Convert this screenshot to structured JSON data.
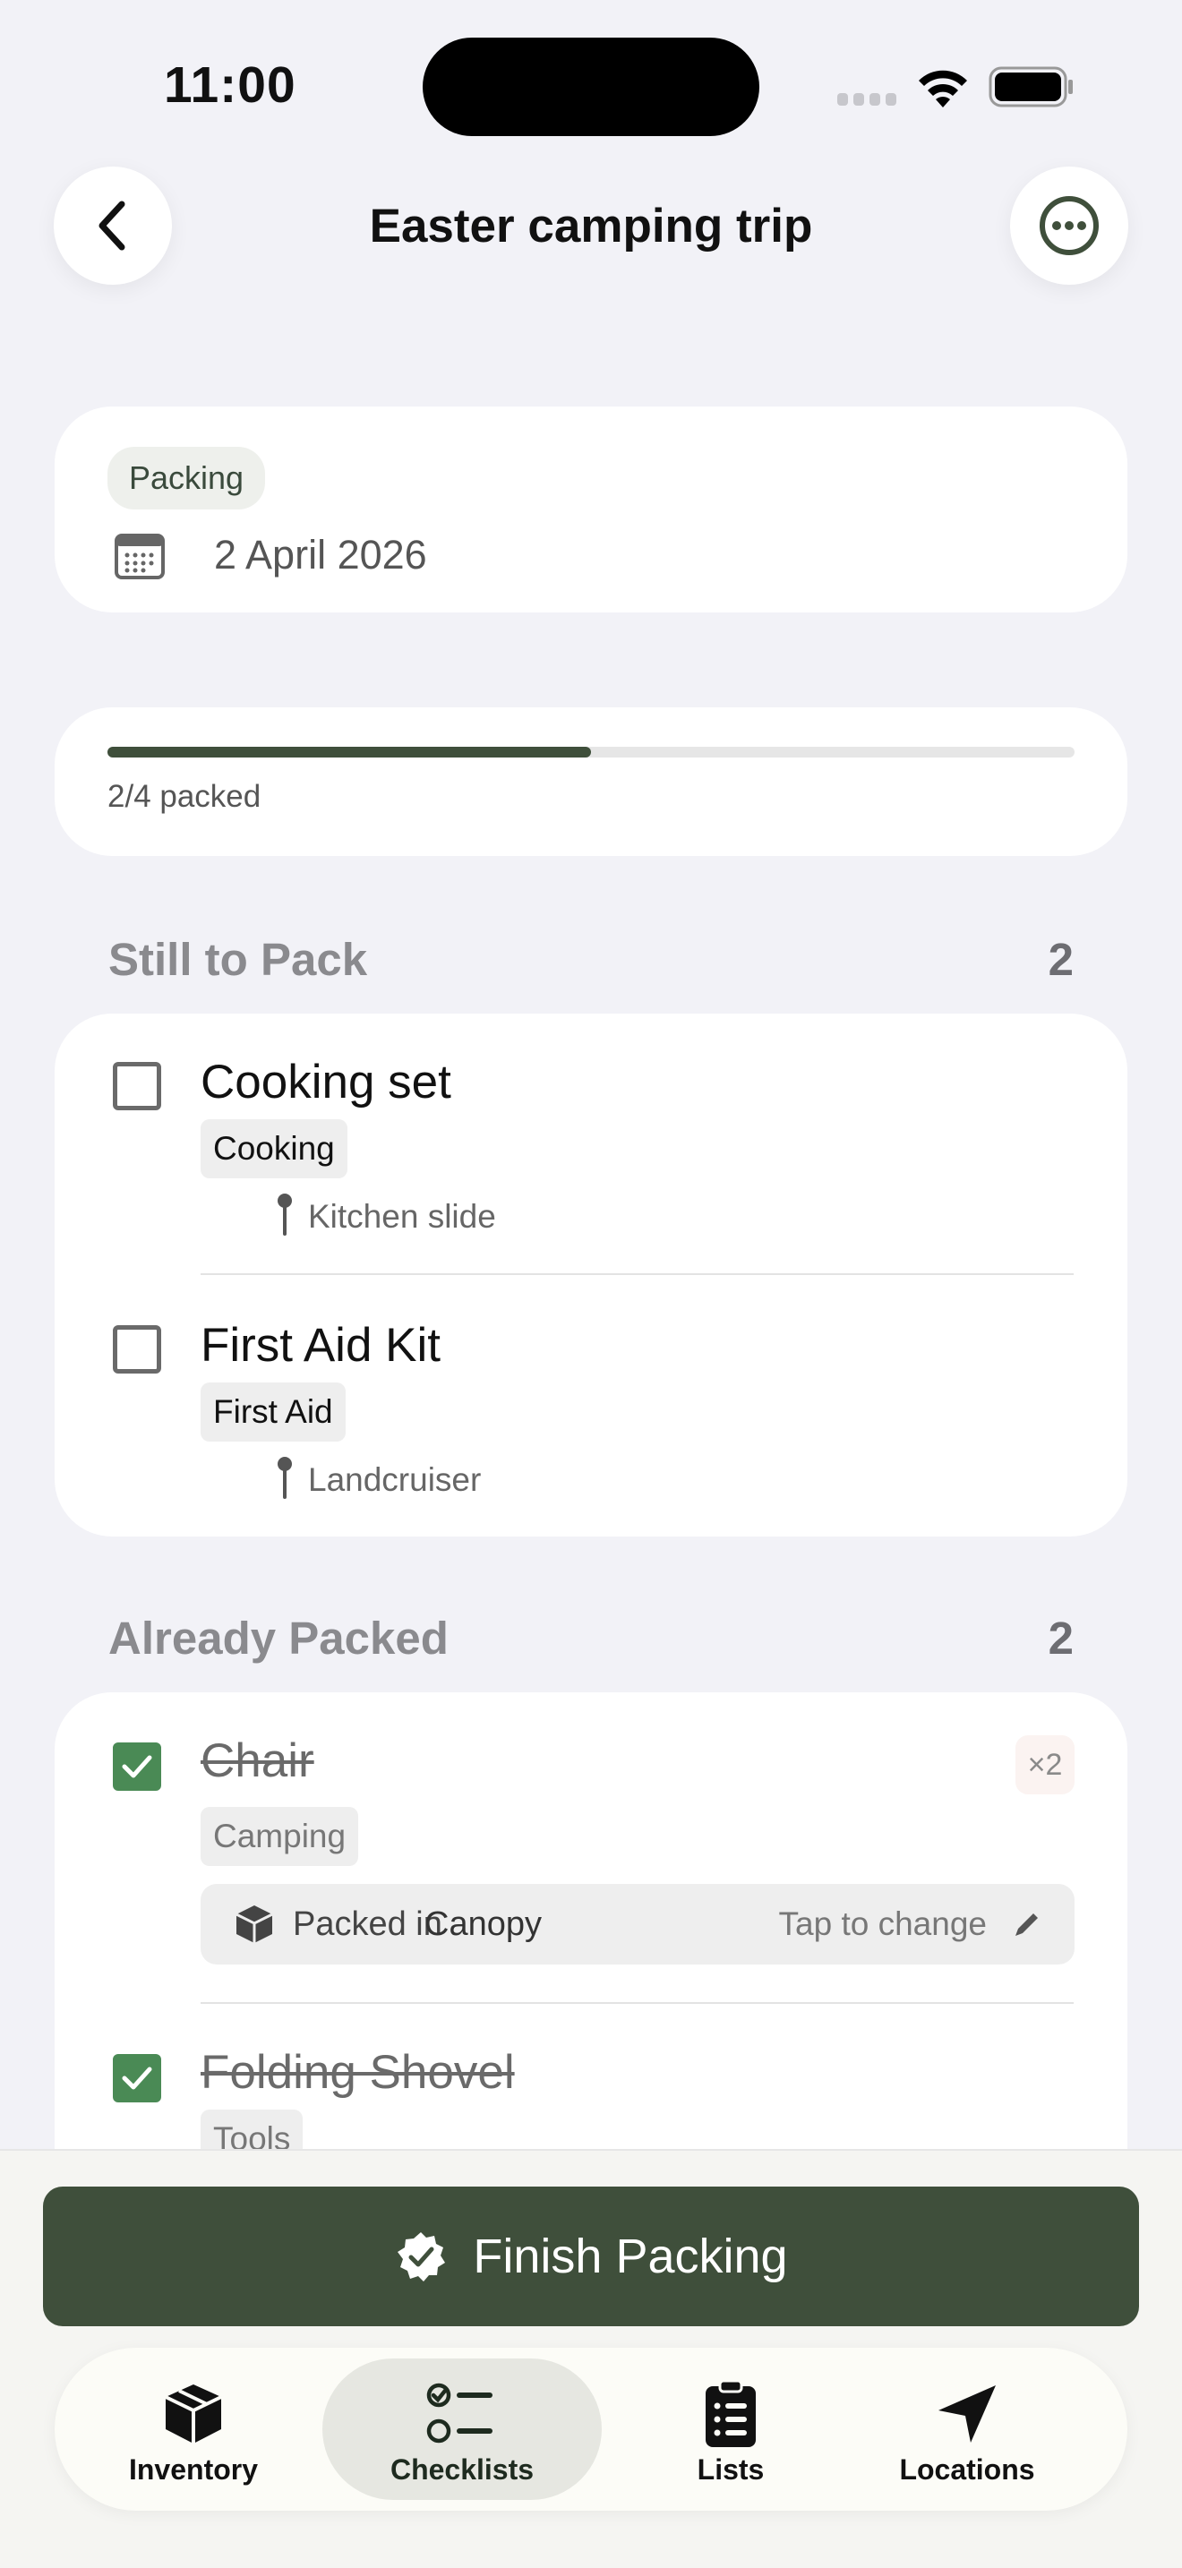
{
  "status_bar": {
    "time": "11:00"
  },
  "nav": {
    "title": "Easter camping trip"
  },
  "summary": {
    "status_pill": "Packing",
    "date": "2 April 2026"
  },
  "progress": {
    "text": "2/4 packed",
    "fraction": 0.5
  },
  "still_to_pack": {
    "title": "Still to Pack",
    "count": "2",
    "items": [
      {
        "name": "Cooking set",
        "tag": "Cooking",
        "location": "Kitchen slide"
      },
      {
        "name": "First Aid Kit",
        "tag": "First Aid",
        "location": "Landcruiser"
      }
    ]
  },
  "already_packed": {
    "title": "Already Packed",
    "count": "2",
    "items": [
      {
        "name": "Chair",
        "tag": "Camping",
        "quantity": "×2",
        "packed_in_label": "Packed in",
        "packed_in_value": "Canopy",
        "packed_in_hint": "Tap to change"
      },
      {
        "name": "Folding Shovel",
        "tag": "Tools"
      }
    ]
  },
  "finish_button": {
    "label": "Finish Packing"
  },
  "tabbar": {
    "tabs": [
      {
        "label": "Inventory",
        "icon": "box-icon"
      },
      {
        "label": "Checklists",
        "icon": "checklist-icon",
        "active": true
      },
      {
        "label": "Lists",
        "icon": "clipboard-list-icon"
      },
      {
        "label": "Locations",
        "icon": "location-arrow-icon"
      }
    ]
  },
  "colors": {
    "accent": "#3f4f3b",
    "check_green": "#4a8a55",
    "background": "#f2f2f7"
  }
}
